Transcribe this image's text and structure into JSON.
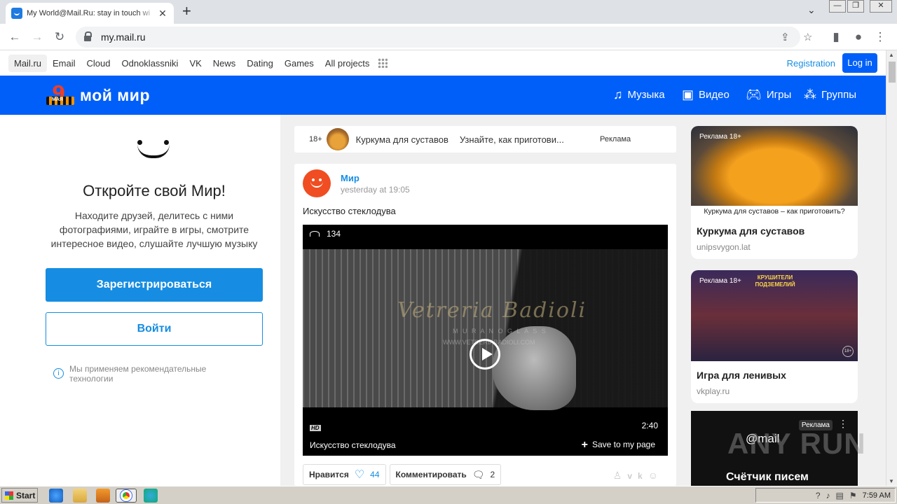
{
  "browser": {
    "tab_title": "My World@Mail.Ru: stay in touch wi",
    "url": "my.mail.ru",
    "win_controls": [
      "—",
      "❐",
      "✕"
    ]
  },
  "portal": {
    "links": [
      "Mail.ru",
      "Email",
      "Cloud",
      "Odnoklassniki",
      "VK",
      "News",
      "Dating",
      "Games",
      "All projects"
    ],
    "registration": "Registration",
    "login": "Log in"
  },
  "header": {
    "logo_text": "мой мир",
    "logo_badge_number": "9",
    "logo_badge_text": "МАЯ",
    "nav": [
      {
        "label": "Музыка",
        "icon": "music-icon"
      },
      {
        "label": "Видео",
        "icon": "video-icon"
      },
      {
        "label": "Игры",
        "icon": "gamepad-icon"
      },
      {
        "label": "Группы",
        "icon": "groups-icon"
      }
    ]
  },
  "left": {
    "title": "Откройте свой Мир!",
    "description": "Находите друзей, делитесь с ними фотографиями, играйте в игры, смотрите интересное видео, слушайте лучшую музыку",
    "register_button": "Зарегистрироваться",
    "login_button": "Войти",
    "recommend_note": "Мы применяем рекомендательные технологии"
  },
  "ad_strip": {
    "age": "18+",
    "title": "Куркума для суставов",
    "teaser": "Узнайте, как приготови...",
    "label": "Реклама"
  },
  "post": {
    "author": "Мир",
    "time": "yesterday at 19:05",
    "text": "Искусство стеклодува",
    "video": {
      "views": "134",
      "watermark": "Vetreria Badioli",
      "watermark_small": "M U R A N O   G L A S S",
      "watermark_url": "WWW.VETRERIABADIOLI.COM",
      "hd": "HD",
      "duration": "2:40",
      "title": "Искусство стеклодува",
      "save": "Save to my page"
    },
    "like_label": "Нравится",
    "like_count": "44",
    "comment_label": "Комментировать",
    "comment_count": "2"
  },
  "right_ads": [
    {
      "tag": "Реклама 18+",
      "caption": "Куркума для суставов – как приготовить?",
      "name": "Куркума для суставов",
      "site": "unipsvygon.lat"
    },
    {
      "tag": "Реклама 18+",
      "image_text": "КРУШИТЕЛИ ПОДЗЕМЕЛИЙ",
      "image_age": "18+",
      "name": "Игра для ленивых",
      "site": "vkplay.ru"
    },
    {
      "tag": "Реклама",
      "logo": "@mail",
      "title": "Счётчик писем"
    }
  ],
  "watermark": "ANY RUN",
  "taskbar": {
    "start": "Start",
    "time": "7:59 AM"
  }
}
